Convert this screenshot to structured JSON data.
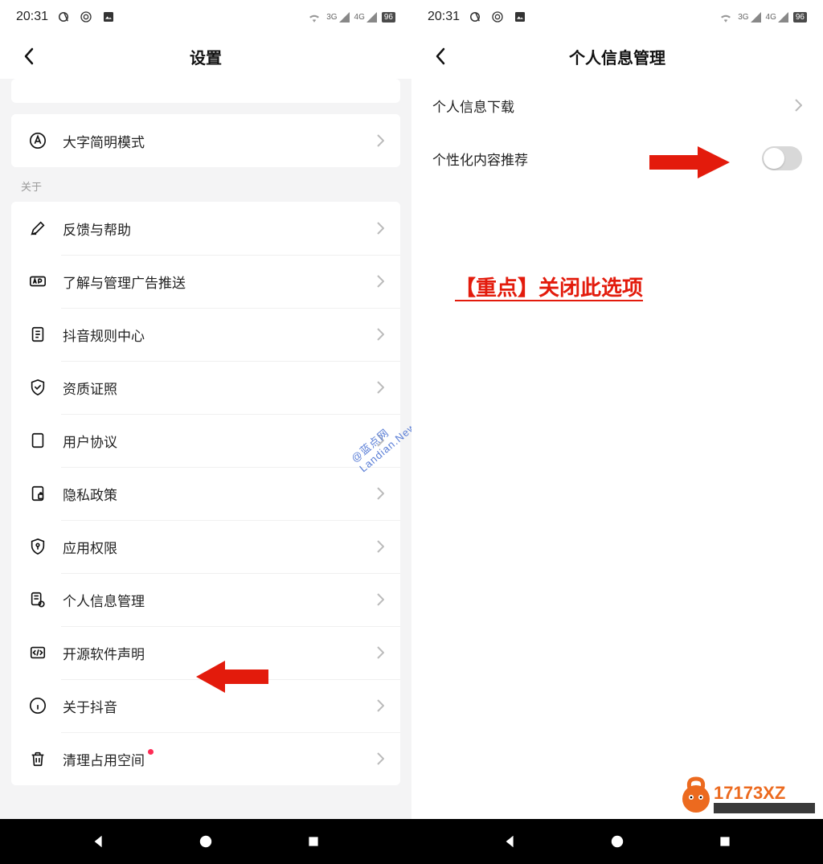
{
  "statusbar": {
    "time": "20:31",
    "net1": "3G",
    "net2": "4G",
    "battery": "96"
  },
  "left": {
    "title": "设置",
    "top_item": "大字简明模式",
    "section_label": "关于",
    "items": [
      {
        "label": "反馈与帮助",
        "icon": "edit-icon"
      },
      {
        "label": "了解与管理广告推送",
        "icon": "ad-icon"
      },
      {
        "label": "抖音规则中心",
        "icon": "doc-icon"
      },
      {
        "label": "资质证照",
        "icon": "shield-check-icon"
      },
      {
        "label": "用户协议",
        "icon": "page-icon"
      },
      {
        "label": "隐私政策",
        "icon": "lock-icon"
      },
      {
        "label": "应用权限",
        "icon": "key-shield-icon"
      },
      {
        "label": "个人信息管理",
        "icon": "info-gear-icon"
      },
      {
        "label": "开源软件声明",
        "icon": "code-icon"
      },
      {
        "label": "关于抖音",
        "icon": "info-icon"
      },
      {
        "label": "清理占用空间",
        "icon": "trash-icon",
        "red_dot": true
      }
    ]
  },
  "right": {
    "title": "个人信息管理",
    "row1": "个人信息下载",
    "row2": "个性化内容推荐",
    "toggle_on": false,
    "annotation": "【重点】关闭此选项"
  },
  "watermark": "@蓝点网 Landian.News",
  "logo_text": "17173XZ"
}
